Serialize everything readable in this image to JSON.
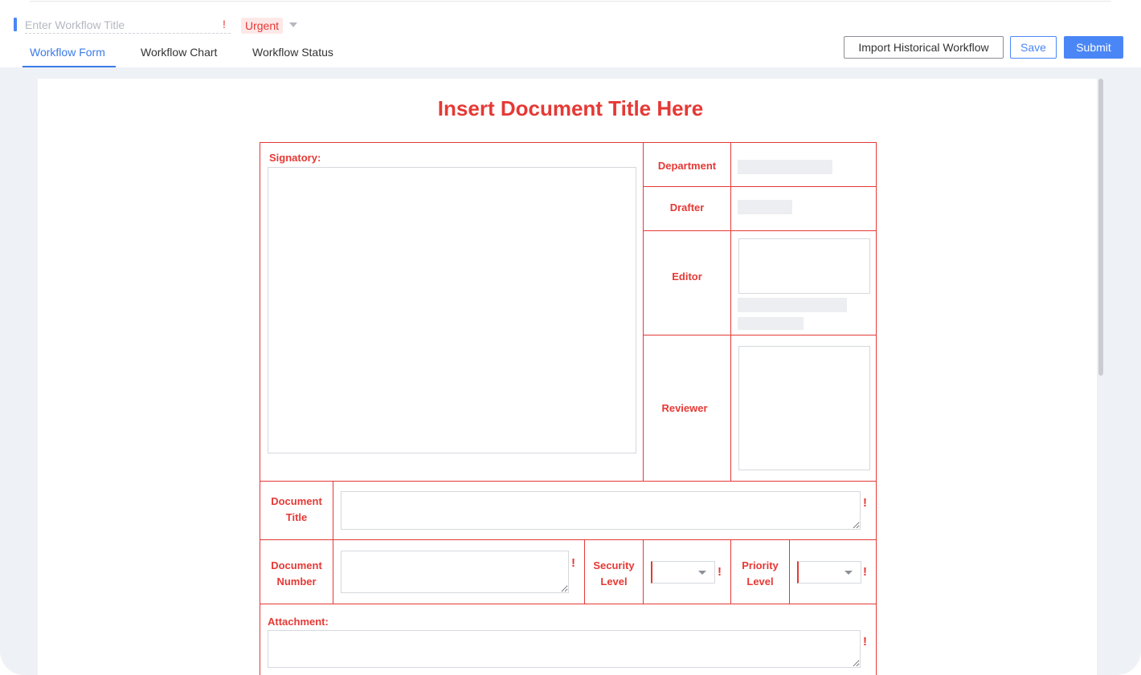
{
  "header": {
    "title_placeholder": "Enter Workflow Title",
    "required_mark": "!",
    "priority_badge": "Urgent"
  },
  "tabs": [
    {
      "label": "Workflow Form",
      "active": true
    },
    {
      "label": "Workflow Chart",
      "active": false
    },
    {
      "label": "Workflow Status",
      "active": false
    }
  ],
  "actions": {
    "import_label": "Import Historical Workflow",
    "save_label": "Save",
    "submit_label": "Submit"
  },
  "form": {
    "doc_title": "Insert Document Title Here",
    "signatory_label": "Signatory:",
    "department_label": "Department",
    "drafter_label": "Drafter",
    "editor_label": "Editor",
    "reviewer_label": "Reviewer",
    "document_title_label_1": "Document",
    "document_title_label_2": "Title",
    "document_number_label_1": "Document",
    "document_number_label_2": "Number",
    "security_level_label_1": "Security",
    "security_level_label_2": "Level",
    "priority_level_label_1": "Priority",
    "priority_level_label_2": "Level",
    "attachment_label": "Attachment:",
    "required_mark": "!"
  },
  "colors": {
    "accent": "#4a86f5",
    "form_red": "#e53935",
    "canvas_bg": "#eef1f6"
  }
}
